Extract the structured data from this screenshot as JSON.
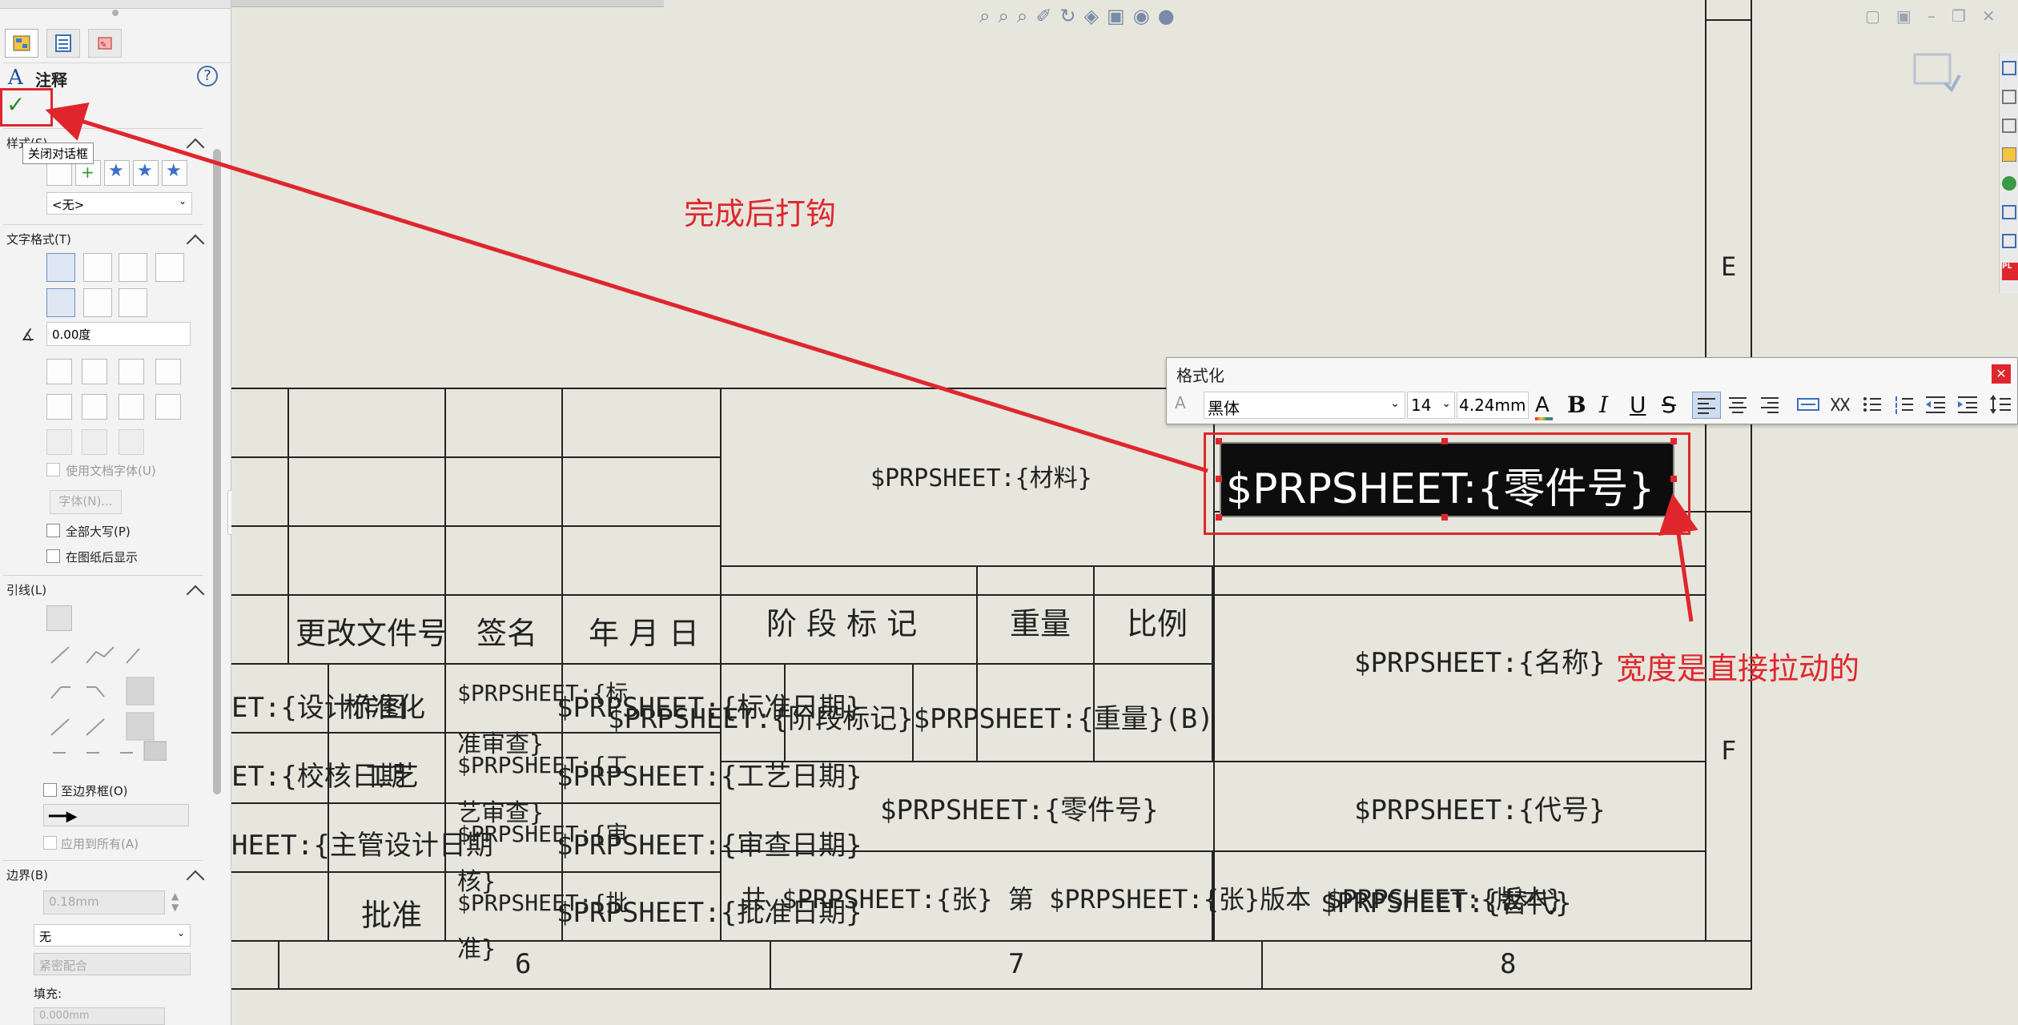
{
  "left_panel": {
    "title": "注释",
    "tooltip": "关闭对话框",
    "style_section": "样式(S)",
    "style_select": "<无>",
    "text_format_section": "文字格式(T)",
    "angle_value": "0.00度",
    "use_doc_font": "使用文档字体(U)",
    "font_button": "字体(N)...",
    "all_caps": "全部大写(P)",
    "show_behind_sheet": "在图纸后显示",
    "leader_section": "引线(L)",
    "to_border": "至边界框(O)",
    "apply_all": "应用到所有(A)",
    "border_section": "边界(B)",
    "border_width": "0.18mm",
    "border_style": "无",
    "fit_style": "紧密配合",
    "fill_label": "填充:",
    "fill_value": "0.000mm"
  },
  "annotations": {
    "check_hint": "完成后打钩",
    "width_hint": "宽度是直接拉动的"
  },
  "format_toolbar": {
    "title": "格式化",
    "font": "黑体",
    "size": "14",
    "height": "4.24mm",
    "bold": "B",
    "italic": "I",
    "underline": "U",
    "strike": "S"
  },
  "selected_text": "$PRPSHEET:{零件号}",
  "title_block": {
    "material": "$PRPSHEET:{材料}",
    "change_doc": "更改文件号",
    "signature": "签名",
    "date": "年 月 日",
    "stage_mark": "阶 段 标 记",
    "weight": "重量",
    "scale": "比例",
    "name": "$PRPSHEET:{名称}",
    "row1_a": "ET:{设计作图",
    "row1_b": "标准化",
    "row1_c": "$PRPSHEET:{标",
    "row1_d": "准审查}",
    "row1_e": "$PRPSHEET:{标准日期}",
    "row1_f": "$PRPSHEET:{阶段标记}$PRPSHEET:{重量}(B)",
    "row2_a": "ET:{校核日期",
    "row2_b": "工艺",
    "row2_c": "$PRPSHEET:{工",
    "row2_d": "艺审查}",
    "row2_e": "$PRPSHEET:{工艺日期}",
    "part_no": "$PRPSHEET:{零件号}",
    "code": "$PRPSHEET:{代号}",
    "row3_a": "HEET:{主管设计日期",
    "row3_b": "$PRPSHEET:{审",
    "row3_c": "核}",
    "row3_d": "$PRPSHEET:{审查日期}",
    "approve": "批准",
    "row4_a": "$PRPSHEET:{批",
    "row4_b": "准}",
    "row4_c": "$PRPSHEET:{批准日期}",
    "row4_d": "共 $PRPSHEET:{张} 第 $PRPSHEET:{张}版本 $PRPSHEET:{版本}",
    "replace": "$PRPSHEET:{替代}",
    "zone_6": "6",
    "zone_7": "7",
    "zone_8": "8",
    "zone_e": "E",
    "zone_f": "F"
  },
  "colors": {
    "annotation_red": "#e0262d",
    "panel_bg": "#f3f3f3",
    "sheet_bg": "#e6e6dc",
    "check_green": "#2c8a2c"
  }
}
